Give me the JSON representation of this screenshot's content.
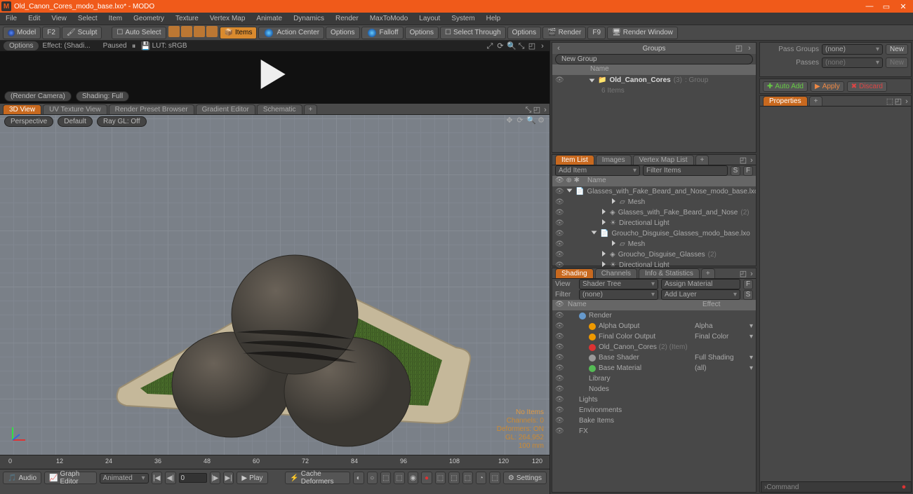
{
  "title": "Old_Canon_Cores_modo_base.lxo* - MODO",
  "app_icon": "M",
  "menubar": [
    "File",
    "Edit",
    "View",
    "Select",
    "Item",
    "Geometry",
    "Texture",
    "Vertex Map",
    "Animate",
    "Dynamics",
    "Render",
    "MaxToModo",
    "Layout",
    "System",
    "Help"
  ],
  "toolbar": {
    "model": "Model",
    "f2": "F2",
    "sculpt": "Sculpt",
    "auto_select": "Auto Select",
    "items": "Items",
    "action_center": "Action Center",
    "options": "Options",
    "falloff": "Falloff",
    "options2": "Options",
    "select_through": "Select Through",
    "options3": "Options",
    "render": "Render",
    "f9": "F9",
    "render_window": "Render Window"
  },
  "preview_bar": {
    "options": "Options",
    "effect": "Effect: (Shadi...",
    "paused": "Paused",
    "lut": "LUT: sRGB"
  },
  "preview_bottom": {
    "camera": "(Render Camera)",
    "shading": "Shading: Full"
  },
  "vp_tabs": [
    "3D View",
    "UV Texture View",
    "Render Preset Browser",
    "Gradient Editor",
    "Schematic"
  ],
  "vp_top": {
    "persp": "Perspective",
    "default": "Default",
    "raygl": "Ray GL: Off"
  },
  "stats": {
    "noitems": "No Items",
    "channels": "Channels: 0",
    "deformers": "Deformers: ON",
    "gl": "GL: 264,952",
    "mm": "100 mm"
  },
  "groups": {
    "title": "Groups",
    "new_group": "New Group",
    "name_hdr": "Name",
    "item": "Old_Canon_Cores",
    "count": "(3)",
    "type": ": Group",
    "sub": "6 Items"
  },
  "passes": {
    "pass_groups": "Pass Groups",
    "pg_val": "(none)",
    "new": "New",
    "passes": "Passes",
    "passes_val": "(none)",
    "new2": "New",
    "auto_add": "Auto Add",
    "apply": "Apply",
    "discard": "Discard"
  },
  "props": {
    "title": "Properties"
  },
  "itemlist": {
    "tabs": [
      "Item List",
      "Images",
      "Vertex Map List"
    ],
    "add": "Add Item",
    "filter": "Filter Items",
    "hdr": [
      "Name"
    ],
    "rows": [
      {
        "icon": "scene",
        "name": "Glasses_with_Fake_Beard_and_Nose_modo_base.lxo"
      },
      {
        "icon": "mesh",
        "name": "Mesh",
        "indent": 2
      },
      {
        "icon": "group",
        "name": "Glasses_with_Fake_Beard_and_Nose",
        "count": "(2)",
        "indent": 1
      },
      {
        "icon": "light",
        "name": "Directional Light",
        "indent": 1
      },
      {
        "icon": "scene",
        "name": "Groucho_Disguise_Glasses_modo_base.lxo"
      },
      {
        "icon": "mesh",
        "name": "Mesh",
        "indent": 2
      },
      {
        "icon": "group",
        "name": "Groucho_Disguise_Glasses",
        "count": "(2)",
        "indent": 1
      },
      {
        "icon": "light",
        "name": "Directional Light",
        "indent": 1
      }
    ]
  },
  "shading": {
    "tabs": [
      "Shading",
      "Channels",
      "Info & Statistics"
    ],
    "view_lbl": "View",
    "view": "Shader Tree",
    "assign": "Assign Material",
    "filter_lbl": "Filter",
    "filter": "(none)",
    "add_layer": "Add Layer",
    "cols": [
      "Name",
      "Effect"
    ],
    "rows": [
      {
        "ic": "blu",
        "name": "Render",
        "eff": ""
      },
      {
        "ic": "orn",
        "name": "Alpha Output",
        "eff": "Alpha",
        "indent": 1
      },
      {
        "ic": "orn",
        "name": "Final Color Output",
        "eff": "Final Color",
        "indent": 1
      },
      {
        "ic": "red",
        "name": "Old_Canon_Cores",
        "count": "(2) (Item)",
        "eff": "",
        "indent": 1
      },
      {
        "ic": "gry",
        "name": "Base Shader",
        "eff": "Full Shading",
        "indent": 1
      },
      {
        "ic": "grn",
        "name": "Base Material",
        "eff": "(all)",
        "indent": 1
      },
      {
        "name": "Library",
        "indent": 1
      },
      {
        "name": "Nodes",
        "indent": 1
      },
      {
        "name": "Lights",
        "indent": 0
      },
      {
        "name": "Environments",
        "indent": 0
      },
      {
        "name": "Bake Items",
        "indent": 0
      },
      {
        "name": "FX",
        "indent": 0
      }
    ]
  },
  "timeline": {
    "audio": "Audio",
    "graph": "Graph Editor",
    "animated": "Animated",
    "play": "Play",
    "cache": "Cache Deformers",
    "settings": "Settings",
    "cur": "0",
    "ticks": [
      "0",
      "12",
      "24",
      "36",
      "48",
      "60",
      "72",
      "84",
      "96",
      "108",
      "120"
    ],
    "max": "120"
  },
  "cmd": {
    "prompt": "Command"
  }
}
